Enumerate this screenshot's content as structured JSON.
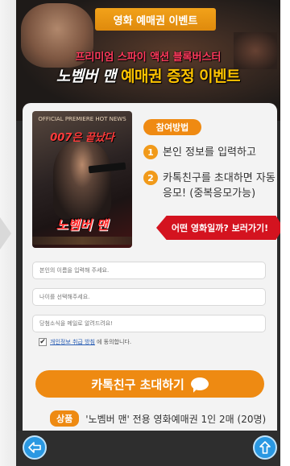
{
  "hero": {
    "ribbon": "영화 예매권 이벤트",
    "subtitle": "프리미엄 스파이 액션 블록버스터",
    "movie_title": "노벰버 맨",
    "event_title": "예매권 증정 이벤트"
  },
  "poster": {
    "top_text": "OFFICIAL PREMIERE HOT NEWS",
    "slogan": "007은 끝났다",
    "title": "노벰버 맨"
  },
  "how_to": {
    "badge": "참여방법",
    "steps": [
      {
        "num": "1",
        "text": "본인 정보를 입력하고"
      },
      {
        "num": "2",
        "text": "카톡친구를 초대하면 자동응모! (중복응모가능)"
      }
    ]
  },
  "trailer_button": "어떤 영화일까? 보러가기!",
  "form": {
    "name_placeholder": "본인의 이름을 입력해 주세요.",
    "age_placeholder": "나이를 선택해주세요.",
    "email_placeholder": "당첨소식을 메일로 알려드려요!",
    "agree_link": "개인정보 취급 방침",
    "agree_text": "에 동의합니다.",
    "agree_checked": true
  },
  "invite_button": "카톡친구 초대하기",
  "prize": {
    "tag": "상품",
    "text": "'노벰버 맨' 전용 영화예매권 1인 2매 (20명)"
  },
  "nav": {
    "back_icon": "back-arrow-icon",
    "top_icon": "up-arrow-icon"
  },
  "colors": {
    "accent": "#ee8a12",
    "red": "#d4131f",
    "nav_blue": "#2a98e2"
  }
}
